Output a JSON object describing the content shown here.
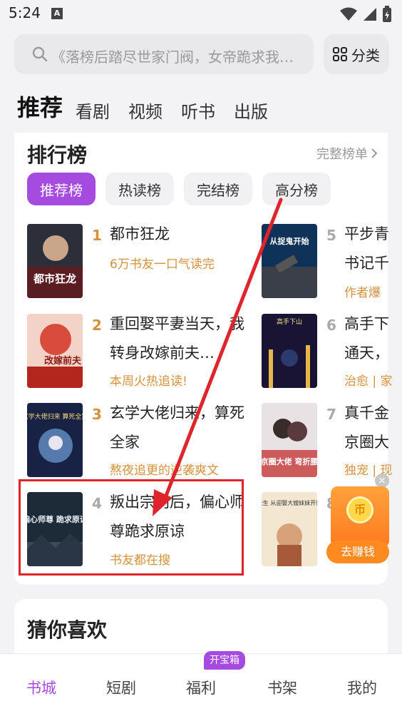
{
  "status": {
    "time": "5:24",
    "a_icon": "A"
  },
  "search": {
    "placeholder": "《落榜后踏尽世家门阀，女帝跪求我…",
    "category_label": "分类"
  },
  "top_tabs": [
    {
      "label": "推荐",
      "active": true
    },
    {
      "label": "看剧"
    },
    {
      "label": "视频"
    },
    {
      "label": "听书"
    },
    {
      "label": "出版"
    }
  ],
  "ranking": {
    "title": "排行榜",
    "more_label": "完整榜单",
    "chips": [
      {
        "label": "推荐榜",
        "active": true
      },
      {
        "label": "热读榜"
      },
      {
        "label": "完结榜"
      },
      {
        "label": "高分榜"
      }
    ],
    "left_books": [
      {
        "rank": "1",
        "title": "都市狂龙",
        "subtitle": "6万书友一口气读完",
        "cover_text": "都市狂龙"
      },
      {
        "rank": "2",
        "title": "重回娶平妻当天，我转身改嫁前夫…",
        "subtitle": "本周火热追读!",
        "cover_text": "改嫁前夫"
      },
      {
        "rank": "3",
        "title": "玄学大佬归来，算死全家",
        "subtitle": "熬夜追更的逆袭爽文",
        "cover_text": "玄学大佬归来 算死全家"
      },
      {
        "rank": "4",
        "title": "叛出宗门后，偏心师尊跪求原谅",
        "subtitle": "书友都在搜",
        "cover_text": "偏心师尊 跪求原谅"
      }
    ],
    "right_books": [
      {
        "rank": "5",
        "title": "平步青书记千",
        "subtitle": "作者爆",
        "cover_text": "从捉鬼开始"
      },
      {
        "rank": "6",
        "title": "高手下通天，",
        "subtitle": "治愈 | 家",
        "cover_text": "高手下山"
      },
      {
        "rank": "7",
        "title": "真千金京圈大",
        "subtitle": "独宠 | 现",
        "cover_text": "京圈大佬 弯折腰"
      },
      {
        "rank": "8",
        "title": "",
        "subtitle": "",
        "cover_text": "长生 从迎娶大嫂妹妹开始"
      }
    ]
  },
  "reward": {
    "coin": "币",
    "label": "去赚钱",
    "close": "×"
  },
  "guess": {
    "title": "猜你喜欢"
  },
  "bottom_nav": {
    "items": [
      {
        "label": "书城",
        "active": true
      },
      {
        "label": "短剧"
      },
      {
        "label": "福利"
      },
      {
        "label": "书架"
      },
      {
        "label": "我的"
      }
    ],
    "badge": "开宝箱"
  },
  "colors": {
    "accent": "#a54be0",
    "rank_gold": "#d4913c",
    "highlight": "#e0242c"
  }
}
